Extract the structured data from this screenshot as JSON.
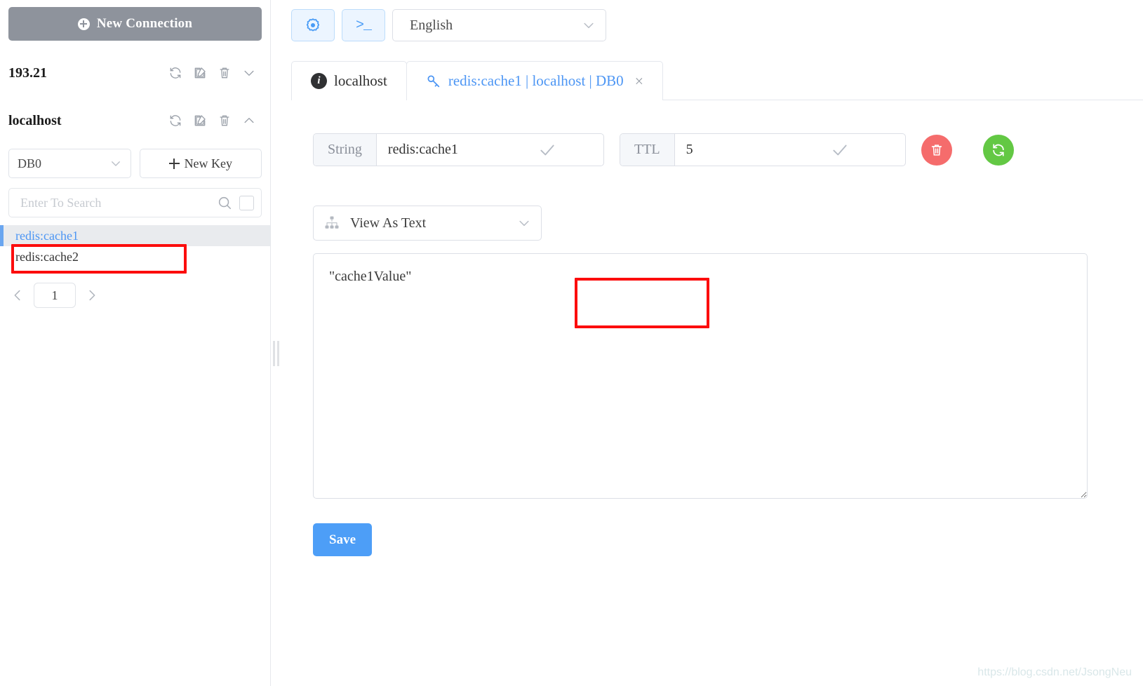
{
  "sidebar": {
    "new_connection_label": "New Connection",
    "connections": [
      {
        "name": "193.21",
        "expanded": false,
        "chevron": "chevron-down-icon"
      },
      {
        "name": "localhost",
        "expanded": true,
        "chevron": "chevron-up-icon"
      }
    ],
    "connection_actions": [
      "refresh-icon",
      "edit-icon",
      "delete-icon"
    ],
    "db_select_value": "DB0",
    "new_key_label": "New Key",
    "search_placeholder": "Enter To Search",
    "search_value": "",
    "keys": [
      {
        "name": "redis:cache1",
        "active": true
      },
      {
        "name": "redis:cache2",
        "active": false
      }
    ],
    "pagination": {
      "page": "1",
      "prev": "chevron-left-icon",
      "next": "chevron-right-icon"
    }
  },
  "toolbar": {
    "settings_icon": "gear-icon",
    "console_icon": "terminal-icon",
    "console_glyph": ">_",
    "language_value": "English"
  },
  "tabs": [
    {
      "label": "localhost",
      "icon": "info-icon",
      "active": false,
      "closable": false
    },
    {
      "label": "redis:cache1 | localhost | DB0",
      "icon": "key-icon",
      "active": true,
      "closable": true,
      "close_glyph": "×"
    }
  ],
  "key_editor": {
    "type_label": "String",
    "key_value": "redis:cache1",
    "key_confirm_icon": "check-icon",
    "ttl_label": "TTL",
    "ttl_value": "5",
    "ttl_confirm_icon": "check-icon",
    "delete_icon": "trash-icon",
    "refresh_icon": "refresh-icon"
  },
  "value_panel": {
    "view_as_label": "View As Text",
    "view_as_icon": "sitemap-icon",
    "view_as_caret": "chevron-down-icon",
    "value": "\"cache1Value\"",
    "save_label": "Save"
  },
  "watermark": "https://blog.csdn.net/JsongNeu",
  "colors": {
    "accent_blue": "#4d96f4",
    "save_blue": "#4d9ef7",
    "delete_red": "#f56c6c",
    "refresh_green": "#63c844",
    "new_connection_gray": "#8e939c",
    "annotation_red": "#fc0d0d"
  }
}
